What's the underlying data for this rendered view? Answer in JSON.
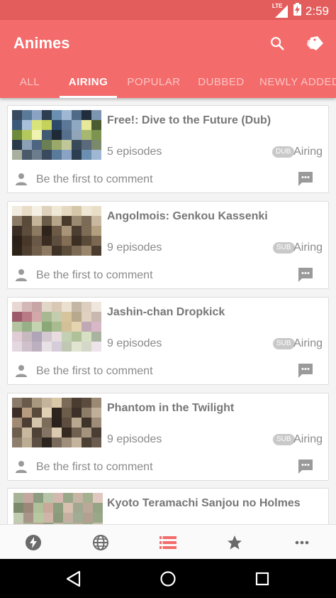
{
  "status_bar": {
    "network": "LTE",
    "battery": "battery-charging-icon",
    "time": "2:59"
  },
  "app_bar": {
    "title": "Animes",
    "search_icon": "search-icon",
    "tag_icon": "tags-icon"
  },
  "tabs": [
    {
      "label": "ALL",
      "active": false
    },
    {
      "label": "AIRING",
      "active": true
    },
    {
      "label": "POPULAR",
      "active": false
    },
    {
      "label": "DUBBED",
      "active": false
    },
    {
      "label": "NEWLY ADDED",
      "active": false
    }
  ],
  "animes": [
    {
      "title": "Free!: Dive to the Future (Dub)",
      "episodes": "5 episodes",
      "badge": "DUB",
      "status": "Airing",
      "comment": "Be the first to comment"
    },
    {
      "title": "Angolmois: Genkou Kassenki",
      "episodes": "9 episodes",
      "badge": "SUB",
      "status": "Airing",
      "comment": "Be the first to comment"
    },
    {
      "title": "Jashin-chan Dropkick",
      "episodes": "9 episodes",
      "badge": "SUB",
      "status": "Airing",
      "comment": "Be the first to comment"
    },
    {
      "title": "Phantom in the Twilight",
      "episodes": "9 episodes",
      "badge": "SUB",
      "status": "Airing",
      "comment": "Be the first to comment"
    },
    {
      "title": "Kyoto Teramachi Sanjou no Holmes",
      "episodes": "",
      "badge": "",
      "status": "",
      "comment": ""
    }
  ],
  "bottom_nav": [
    {
      "icon": "lightning-icon",
      "active": false
    },
    {
      "icon": "globe-icon",
      "active": false
    },
    {
      "icon": "list-icon",
      "active": true
    },
    {
      "icon": "star-icon",
      "active": false
    },
    {
      "icon": "more-icon",
      "active": false
    }
  ],
  "colors": {
    "primary": "#f46b6b",
    "status_bar": "#e45d5d",
    "accent": "#f46b6b",
    "text_muted": "#8a8a8a"
  }
}
